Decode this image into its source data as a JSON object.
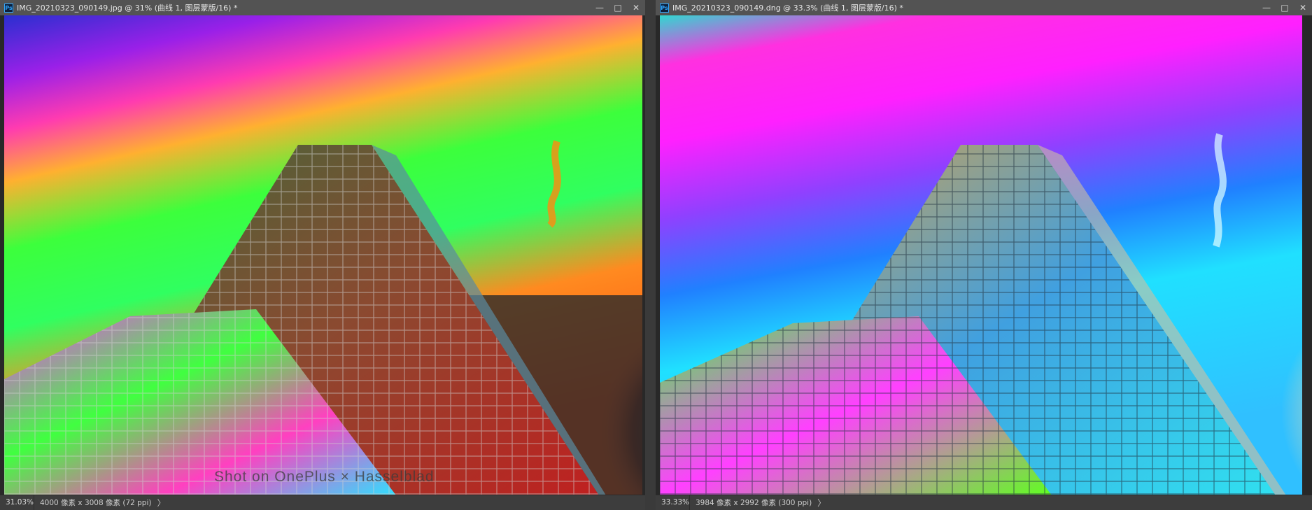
{
  "windows": {
    "left": {
      "title": "IMG_20210323_090149.jpg @ 31% (曲线 1, 图层蒙版/16) *",
      "zoom": "31.03%",
      "doc_info": "4000 像素 x 3008 像素 (72 ppi)",
      "status_arrow": "〉",
      "watermark": "Shot on OnePlus × Hasselblad",
      "controls": {
        "minimize": "—",
        "maximize": "□",
        "close": "✕"
      }
    },
    "right": {
      "title": "IMG_20210323_090149.dng @ 33.3% (曲线 1, 图层蒙版/16) *",
      "zoom": "33.33%",
      "doc_info": "3984 像素 x 2992 像素 (300 ppi)",
      "status_arrow": "〉",
      "controls": {
        "minimize": "—",
        "maximize": "□",
        "close": "✕"
      }
    }
  },
  "app_icon": "photoshop-icon",
  "colors": {
    "titlebar": "#535353",
    "statusbar": "#3d3d3d",
    "workspace": "#3a3a3a",
    "ps_blue": "#31a8ff"
  }
}
